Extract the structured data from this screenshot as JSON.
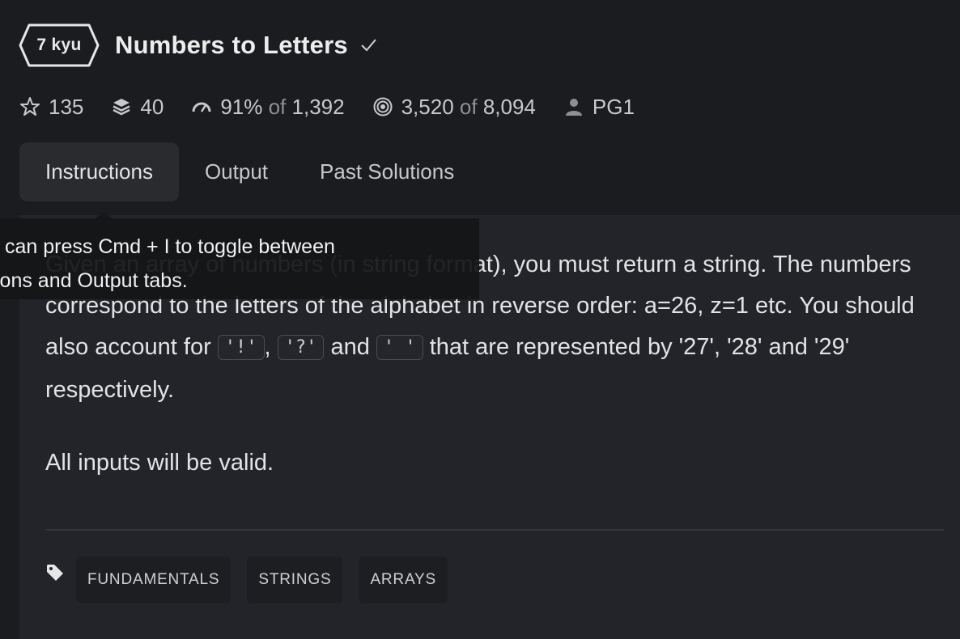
{
  "kata": {
    "rank": "7 kyu",
    "title": "Numbers to Letters"
  },
  "stats": {
    "stars": "135",
    "collections": "40",
    "satisfaction_pct": "91%",
    "satisfaction_of": "of",
    "satisfaction_votes": "1,392",
    "completed": "3,520",
    "completed_of": "of",
    "attempts": "8,094",
    "author": "PG1"
  },
  "tabs": [
    {
      "label": "Instructions",
      "active": true
    },
    {
      "label": "Output",
      "active": false
    },
    {
      "label": "Past Solutions",
      "active": false
    }
  ],
  "description": {
    "p1_a": "Given an array of numbers (in string format), you must return a string. The numbers correspond to the letters of the alphabet in reverse order: a=26, z=1 etc. You should also account for ",
    "code1": "'!'",
    "sep1": ", ",
    "code2": "'?'",
    "sep2": " and ",
    "code3": "' '",
    "p1_b": " that are represented by '27', '28' and '29' respectively.",
    "p2": "All inputs will be valid."
  },
  "tags": [
    "FUNDAMENTALS",
    "STRINGS",
    "ARRAYS"
  ],
  "tooltip": {
    "line1": "can press Cmd + I to toggle between",
    "line2": "ions and Output tabs."
  },
  "icons": {
    "rank": "hexagon-badge-icon",
    "check": "check-icon",
    "star": "star-icon",
    "collections": "layers-icon",
    "satisfaction": "gauge-icon",
    "completed": "target-icon",
    "author": "user-icon",
    "tags": "tag-icon"
  }
}
